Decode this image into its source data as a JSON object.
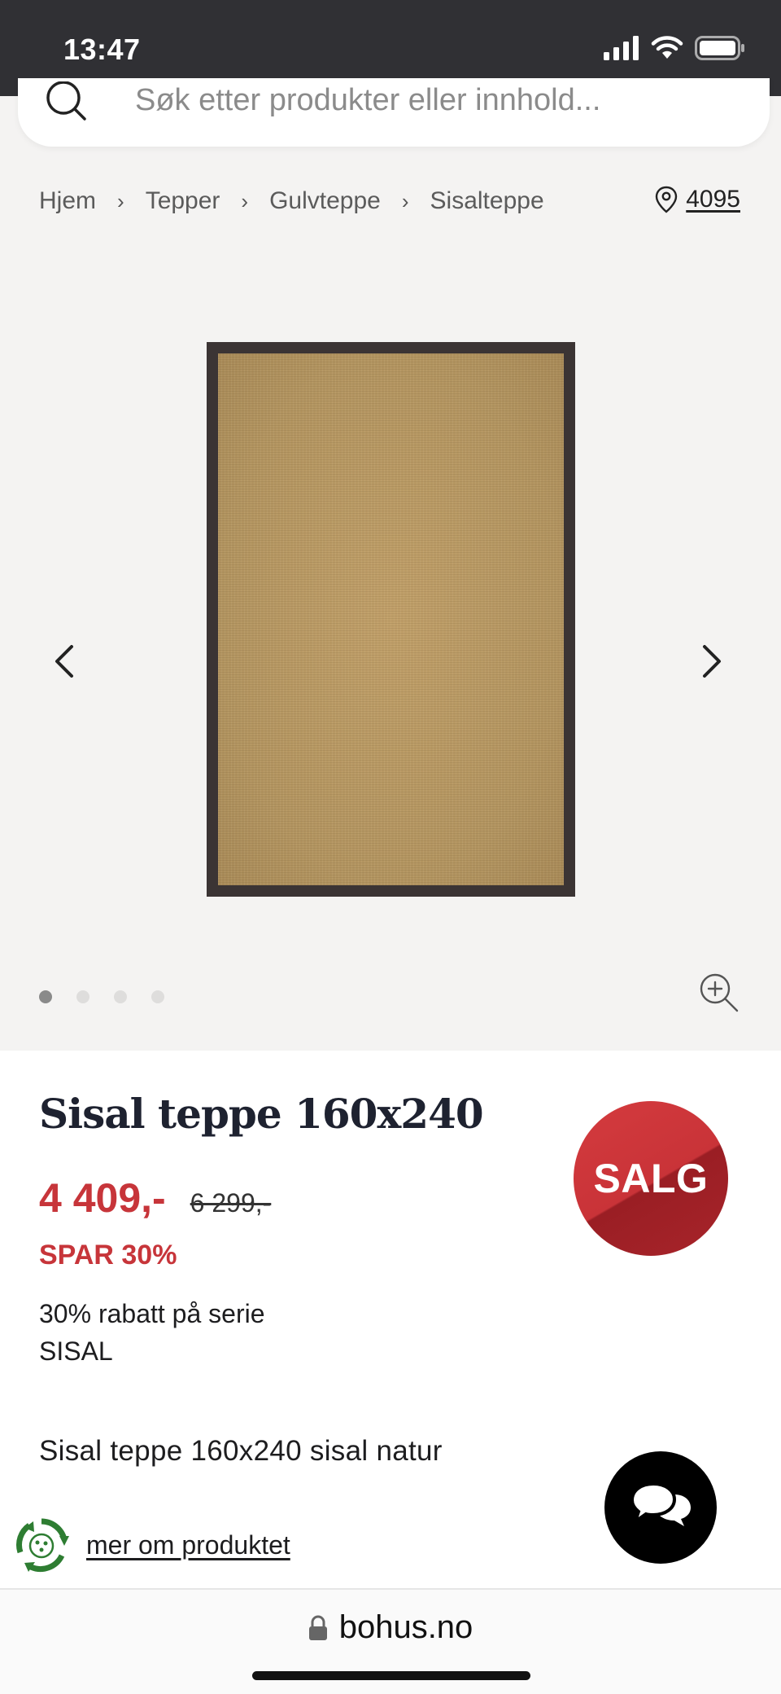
{
  "status": {
    "time": "13:47"
  },
  "search": {
    "placeholder": "Søk etter produkter eller innhold..."
  },
  "breadcrumb": {
    "items": [
      "Hjem",
      "Tepper",
      "Gulvteppe",
      "Sisalteppe"
    ],
    "store": "4095"
  },
  "gallery": {
    "total_images": 4,
    "active_index": 0
  },
  "product": {
    "title": "Sisal teppe 160x240",
    "price": "4 409,-",
    "old_price": "6 299,-",
    "save": "SPAR 30%",
    "promo": "30% rabatt på serie SISAL",
    "badge": "SALG",
    "description": "Sisal teppe 160x240 sisal natur",
    "more_link": "mer om produktet"
  },
  "browser": {
    "url": "bohus.no"
  },
  "colors": {
    "sale_red": "#c7353a",
    "title_navy": "#1e2230",
    "gallery_bg": "#f4f3f2",
    "eco_green": "#3a7a3a"
  }
}
